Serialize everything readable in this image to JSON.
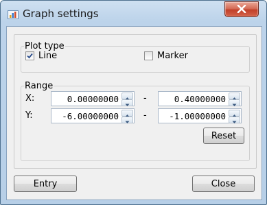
{
  "window": {
    "title": "Graph settings",
    "app_icon": "chart-app-icon",
    "close_icon": "close-icon"
  },
  "plot_type": {
    "legend": "Plot type",
    "line": {
      "label": "Line",
      "checked": true
    },
    "marker": {
      "label": "Marker",
      "checked": false
    }
  },
  "range": {
    "legend": "Range",
    "x": {
      "label": "X:",
      "min": "0.00000000",
      "max": "0.40000000"
    },
    "y": {
      "label": "Y:",
      "min": "-6.00000000",
      "max": "-1.00000000"
    },
    "separator": "-",
    "reset_label": "Reset"
  },
  "footer": {
    "entry_label": "Entry",
    "close_label": "Close"
  }
}
